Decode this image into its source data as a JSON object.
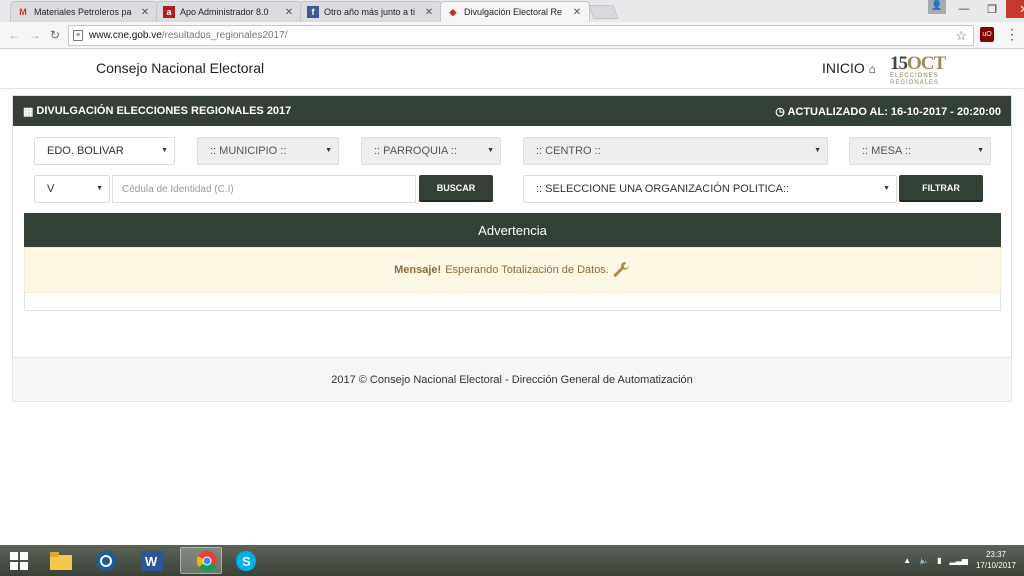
{
  "browser": {
    "tabs": [
      {
        "title": "Materiales Petroleros pa",
        "favicon": "gmail-icon"
      },
      {
        "title": "Apo Administrador 8.0",
        "favicon": "a-icon"
      },
      {
        "title": "Otro año más junto a ti",
        "favicon": "facebook-icon"
      },
      {
        "title": "Divulgación Electoral Re",
        "favicon": "cne-icon"
      }
    ],
    "url_host": "www.cne.gob.ve",
    "url_path": "/resultados_regionales2017/"
  },
  "header": {
    "brand": "Consejo Nacional Electoral",
    "inicio": "INICIO",
    "logo_number": "15",
    "logo_oct": "OCT",
    "logo_line1": "ELECCIONES",
    "logo_line2": "REGIONALES"
  },
  "panel": {
    "title": "DIVULGACIÓN ELECCIONES REGIONALES 2017",
    "updated": "ACTUALIZADO AL: 16-10-2017 - 20:20:00"
  },
  "filters": {
    "estado": "EDO. BOLIVAR",
    "municipio": ":: MUNICIPIO ::",
    "parroquia": ":: PARROQUIA ::",
    "centro": ":: CENTRO ::",
    "mesa": ":: MESA ::",
    "nacionalidad": "V",
    "cedula_placeholder": "Cédula de Identidad (C.I)",
    "buscar": "BUSCAR",
    "organizacion": ":: SELECCIONE UNA ORGANIZACIÓN POLITICA::",
    "filtrar": "FILTRAR"
  },
  "warning": {
    "title": "Advertencia",
    "label": "Mensaje!",
    "text": "Esperando Totalización de Datos."
  },
  "footer": {
    "text": "2017 © Consejo Nacional Electoral - Dirección General de Automatización"
  },
  "taskbar": {
    "time": "23:37",
    "date": "17/10/2017"
  }
}
